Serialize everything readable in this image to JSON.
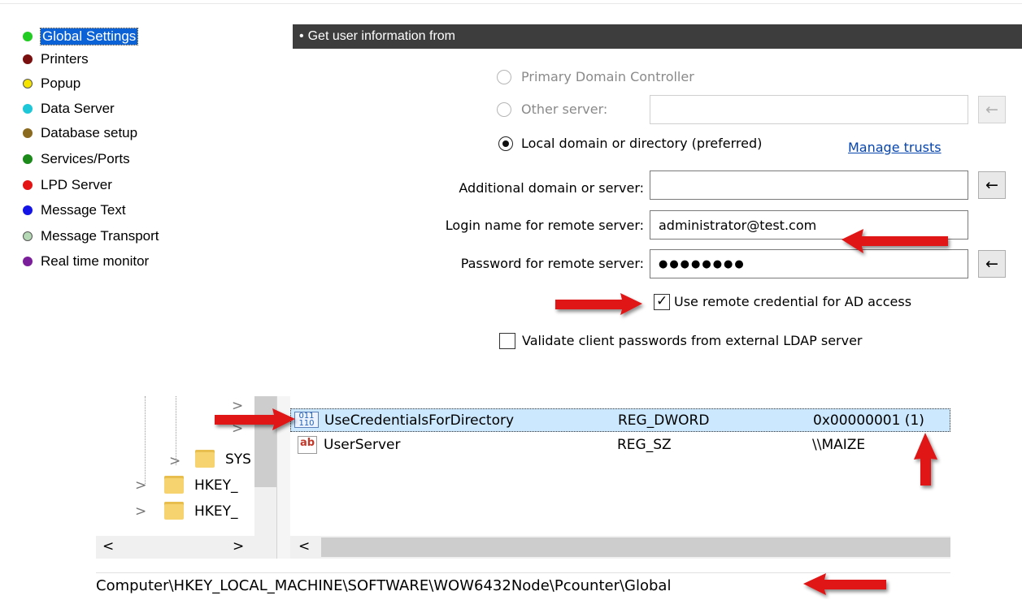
{
  "sidebar": {
    "items": [
      {
        "label": "Global Settings",
        "color": "#22cc22",
        "selected": true
      },
      {
        "label": "Printers",
        "color": "#7a0f0f"
      },
      {
        "label": "Popup",
        "color": "#f5e400"
      },
      {
        "label": "Data Server",
        "color": "#1ec7d8"
      },
      {
        "label": "Database setup",
        "color": "#8a6a1f"
      },
      {
        "label": "Services/Ports",
        "color": "#1b8a1b"
      },
      {
        "label": "LPD Server",
        "color": "#e41414"
      },
      {
        "label": "Message Text",
        "color": "#1414e6"
      },
      {
        "label": "Message Transport",
        "color": "#b4d8b4"
      },
      {
        "label": "Real time monitor",
        "color": "#7b1e9a"
      }
    ]
  },
  "header": {
    "bullet": "•",
    "title": "Get user information from"
  },
  "options": {
    "primary_domain_controller": "Primary Domain Controller",
    "other_server": "Other server:",
    "local_domain": "Local domain or directory (preferred)",
    "manage_trusts": "Manage trusts"
  },
  "fields": {
    "additional_label": "Additional domain or server:",
    "additional_value": "",
    "login_label": "Login name for remote server:",
    "login_value": "administrator@test.com",
    "password_label": "Password for remote server:",
    "password_value": "●●●●●●●●"
  },
  "checkboxes": {
    "use_remote": {
      "label": "Use remote credential for AD access",
      "checked": true
    },
    "validate_ldap": {
      "label": "Validate client passwords from external LDAP server",
      "checked": false
    }
  },
  "icons": {
    "arrow_left": "←",
    "check": "✓",
    "scroll_left": "<",
    "scroll_right": ">",
    "chevron_down": "⌄",
    "expand": ">"
  },
  "registry": {
    "tree_items": [
      "SYS",
      "HKEY_",
      "HKEY_"
    ],
    "rows": [
      {
        "name": "UseCredentialsForDirectory",
        "type": "REG_DWORD",
        "data": "0x00000001 (1)",
        "icon": "binary-value-icon",
        "selected": true
      },
      {
        "name": "UserServer",
        "type": "REG_SZ",
        "data": "\\\\MAIZE",
        "icon": "string-value-icon",
        "icon_text": "ab"
      }
    ],
    "status_path": "Computer\\HKEY_LOCAL_MACHINE\\SOFTWARE\\WOW6432Node\\Pcounter\\Global"
  }
}
